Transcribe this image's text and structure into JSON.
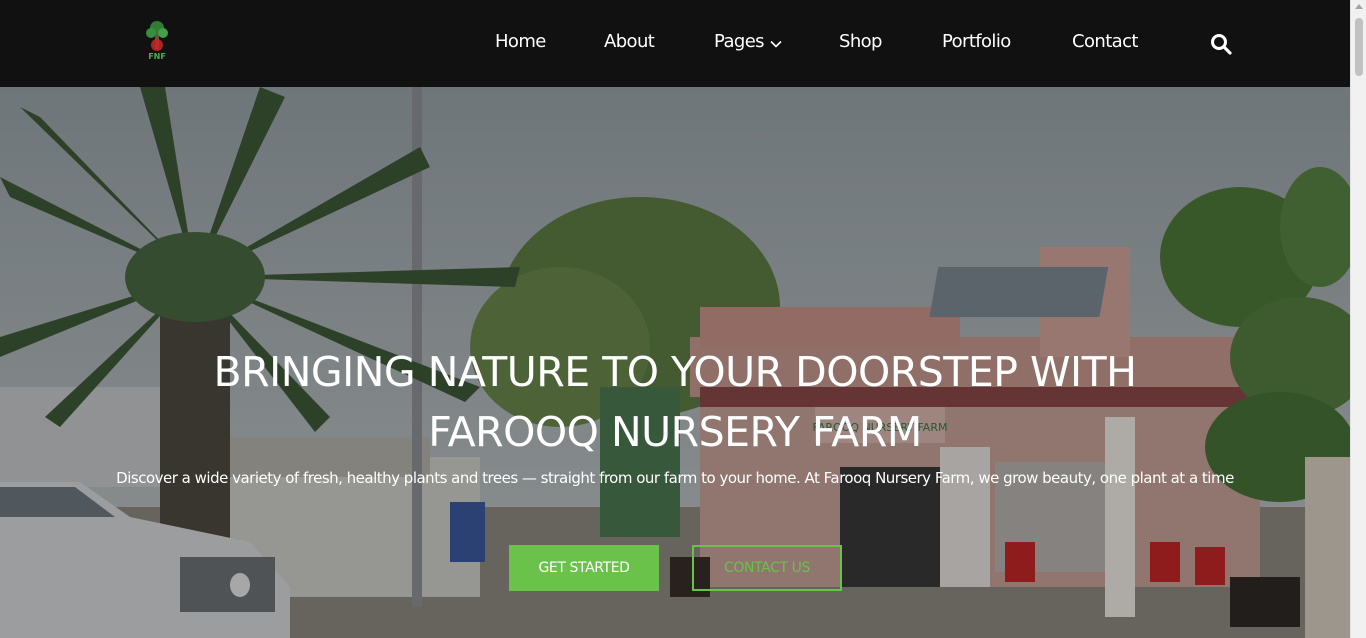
{
  "brand": {
    "logo_text": "FNF",
    "logo_icon": "tree-logo-icon"
  },
  "nav": {
    "items": [
      {
        "label": "Home"
      },
      {
        "label": "About"
      },
      {
        "label": "Pages",
        "has_dropdown": true
      },
      {
        "label": "Shop"
      },
      {
        "label": "Portfolio"
      },
      {
        "label": "Contact"
      }
    ],
    "search_icon": "search-icon"
  },
  "hero": {
    "title": "BRINGING NATURE TO YOUR DOORSTEP WITH FAROOQ NURSERY FARM",
    "subtitle": "Discover a wide variety of fresh, healthy plants and trees — straight from our farm to your home. At Farooq Nursery Farm, we grow beauty, one plant at a time",
    "primary_button": "GET STARTED",
    "secondary_button": "CONTACT US",
    "background_sign": "FAROOQ NURSERY FARM"
  },
  "colors": {
    "navbar_bg": "#111111",
    "accent_green": "#6ac24a",
    "text_white": "#ffffff"
  }
}
